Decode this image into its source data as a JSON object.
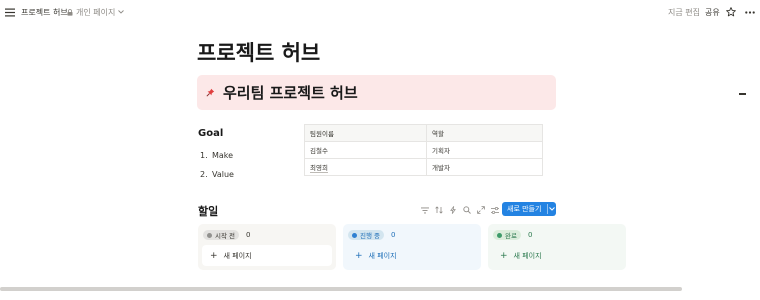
{
  "topbar": {
    "breadcrumb": "프로젝트 허브",
    "workspace": "개인 페이지",
    "edited": "지금 편집",
    "share": "공유"
  },
  "page": {
    "title": "프로젝트 허브",
    "callout_icon": "pushpin-icon",
    "callout_title": "우리팀 프로젝트 허브"
  },
  "goal": {
    "heading": "Goal",
    "items": [
      {
        "num": "1.",
        "text": "Make"
      },
      {
        "num": "2.",
        "text": "Value"
      }
    ]
  },
  "team_table": {
    "headers": [
      "팀원이름",
      "역할"
    ],
    "rows": [
      [
        "김철수",
        "기획자"
      ],
      [
        "최영희",
        "개발자"
      ]
    ]
  },
  "todo": {
    "heading": "할일",
    "new_button": "새로 만들기",
    "tools": [
      "filter-icon",
      "sort-icon",
      "lightning-icon",
      "search-icon",
      "expand-icon",
      "settings-icon"
    ],
    "columns": [
      {
        "status": "시작 전",
        "count": "0",
        "new_page": "새 페이지",
        "color": "#91918e",
        "bg": "#f7f6f3",
        "pill_bg": "#e3e2e0",
        "text_color": "#37352f"
      },
      {
        "status": "진행 중",
        "count": "0",
        "new_page": "새 페이지",
        "color": "#2f80d1",
        "bg": "#f1f7fc",
        "pill_bg": "#d3e5ef",
        "text_color": "#1f6fb8"
      },
      {
        "status": "완료",
        "count": "0",
        "new_page": "새 페이지",
        "color": "#3e9b6a",
        "bg": "#f3f8f4",
        "pill_bg": "#dbeddb",
        "text_color": "#2d7a4f"
      }
    ]
  }
}
